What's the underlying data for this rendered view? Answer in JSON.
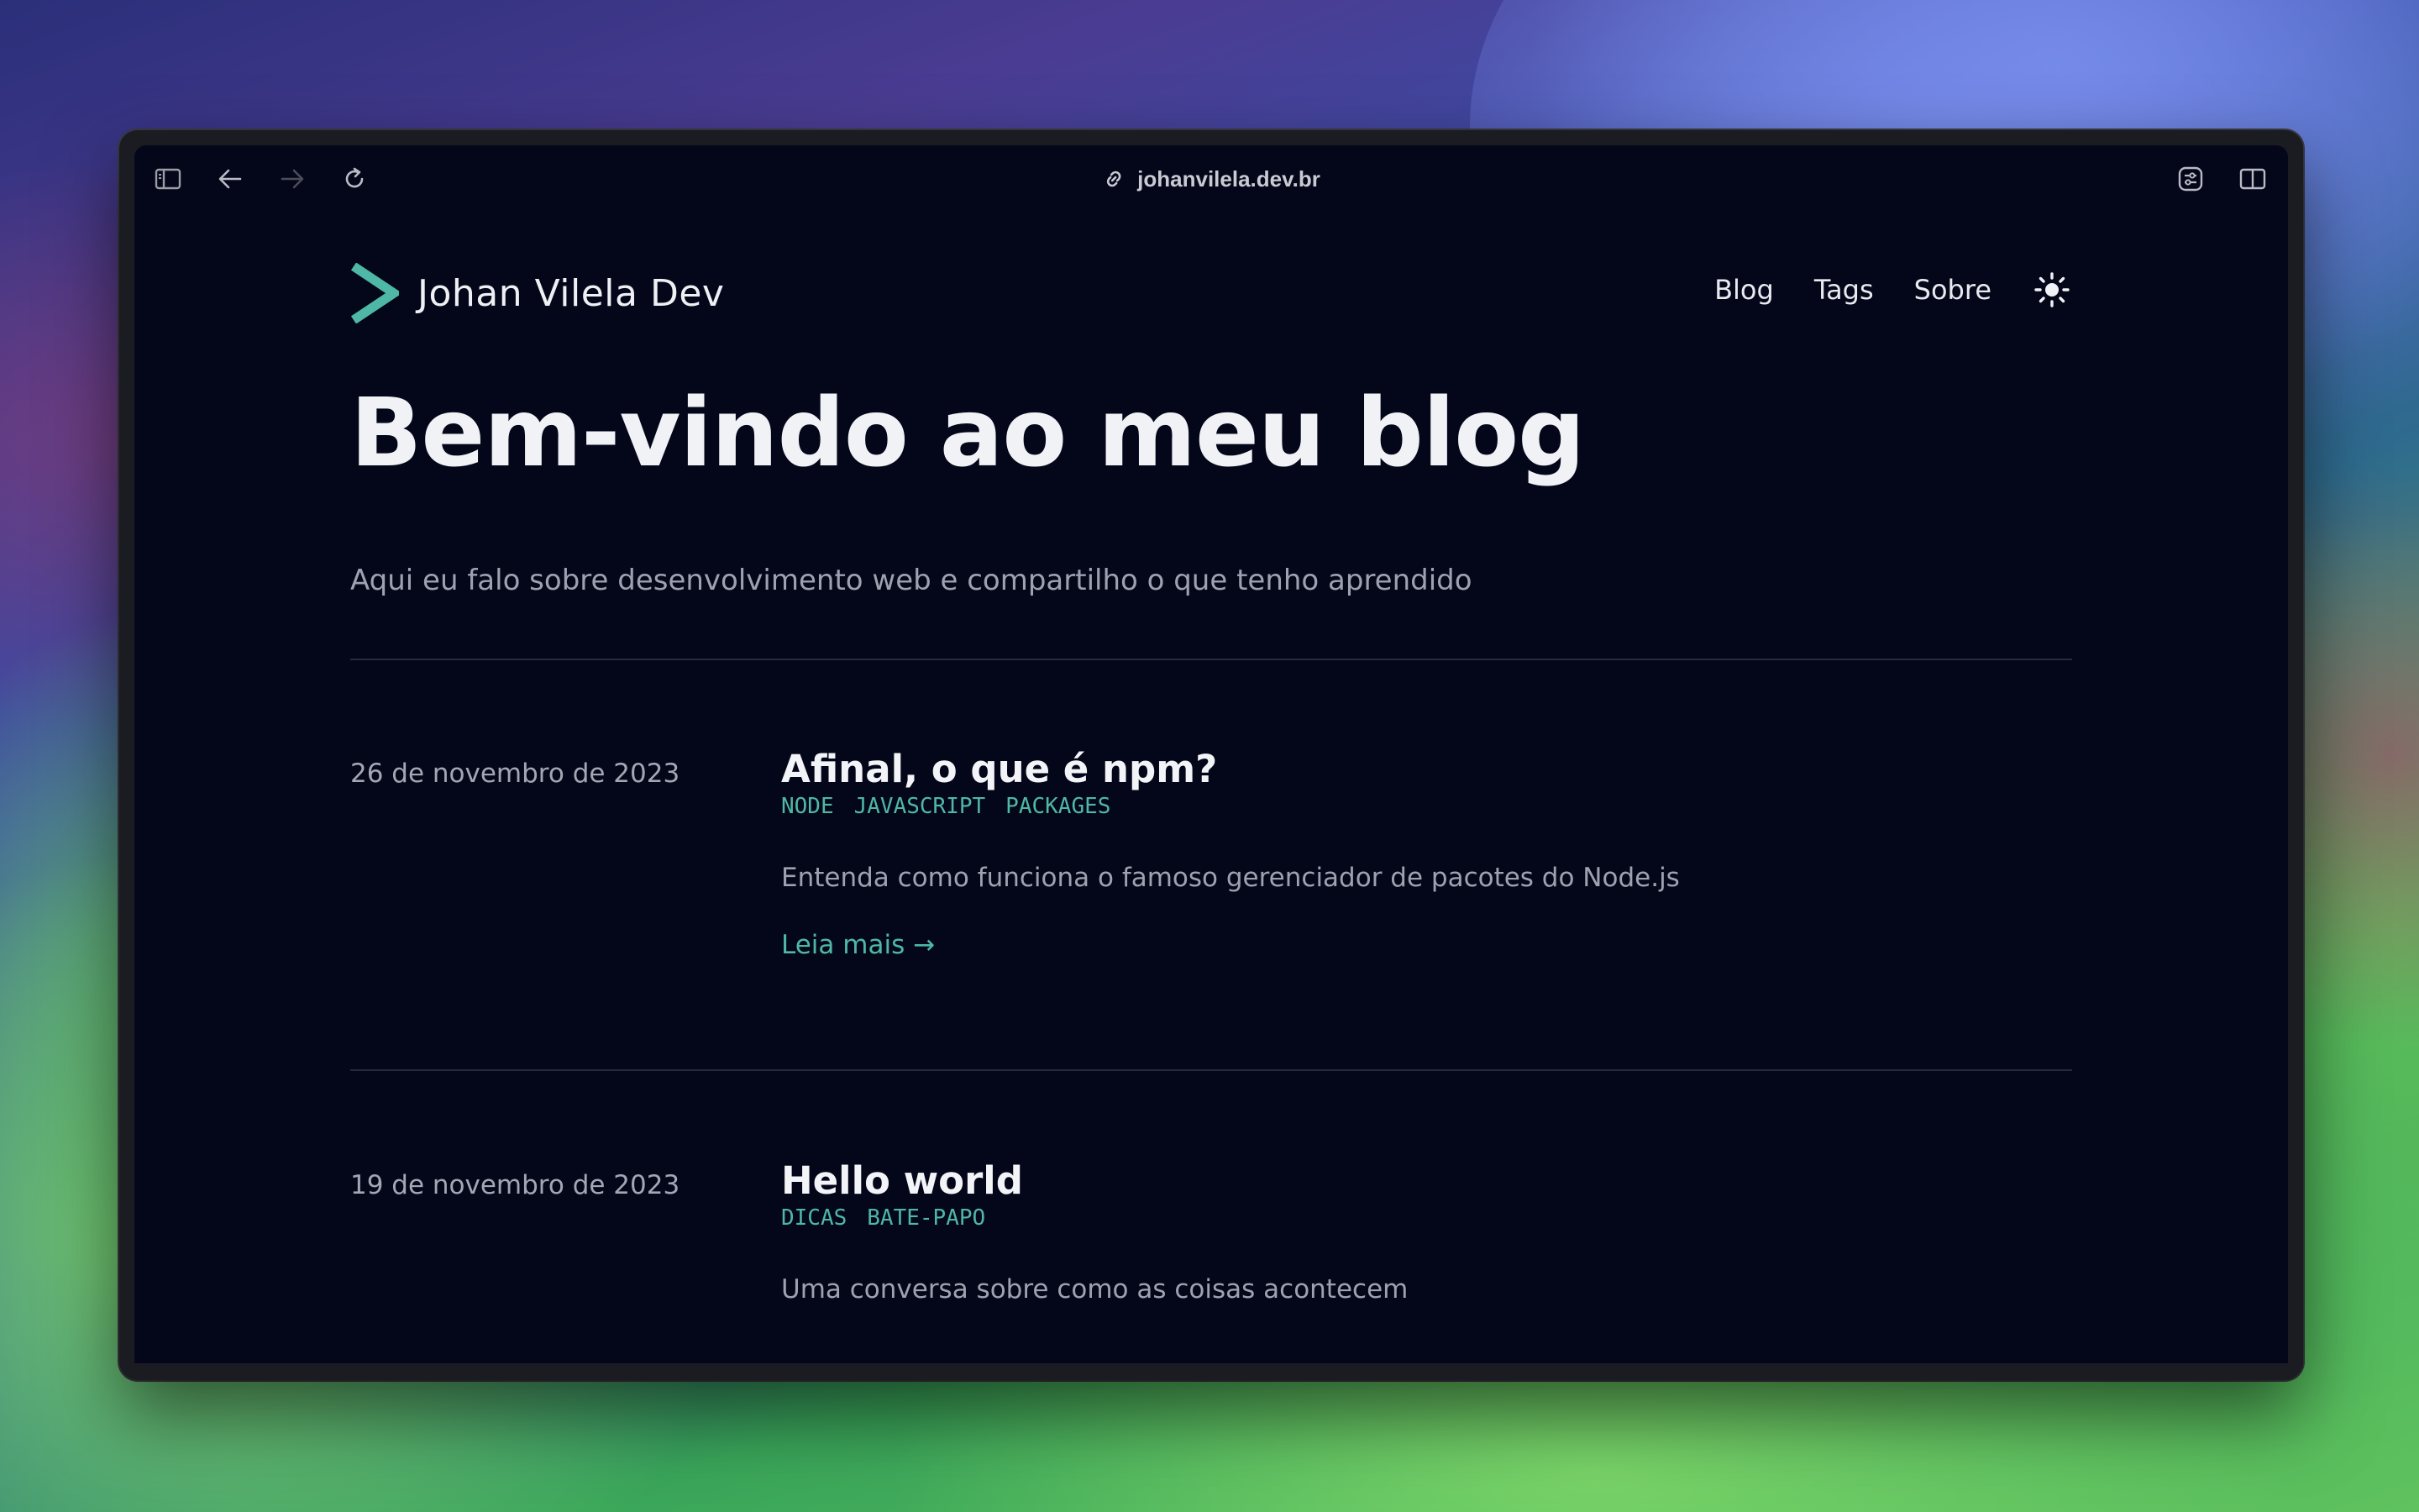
{
  "browser": {
    "url": "johanvilela.dev.br",
    "icons": {
      "sidebar": "sidebar-icon",
      "back": "arrow-left-icon",
      "forward": "arrow-right-icon",
      "reload": "reload-icon",
      "link": "link-icon",
      "extensions": "extensions-icon",
      "split_view": "split-view-icon"
    }
  },
  "site": {
    "brand": "Johan Vilela Dev",
    "nav": [
      "Blog",
      "Tags",
      "Sobre"
    ],
    "theme_icon": "sun-icon",
    "accent_color": "#4fb7a5",
    "background_color": "#04071a"
  },
  "hero": {
    "title": "Bem-vindo ao meu blog",
    "subtitle": "Aqui eu falo sobre desenvolvimento web e compartilho o que tenho aprendido"
  },
  "posts": [
    {
      "date": "26 de novembro de 2023",
      "title": "Afinal, o que é npm?",
      "tags": [
        "NODE",
        "JAVASCRIPT",
        "PACKAGES"
      ],
      "description": "Entenda como funciona o famoso gerenciador de pacotes do Node.js",
      "read_more": "Leia mais →"
    },
    {
      "date": "19 de novembro de 2023",
      "title": "Hello world",
      "tags": [
        "DICAS",
        "BATE-PAPO"
      ],
      "description": "Uma conversa sobre como as coisas acontecem"
    }
  ]
}
